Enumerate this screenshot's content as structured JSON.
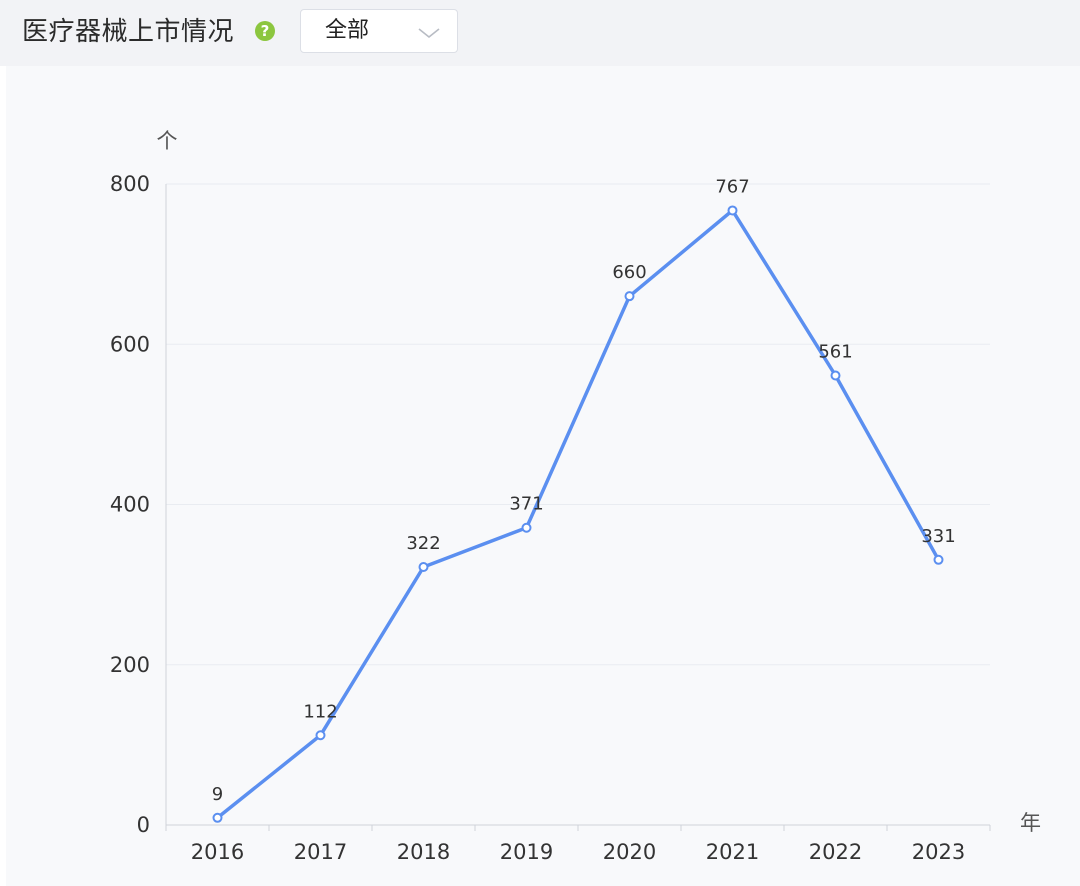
{
  "header": {
    "title": "医疗器械上市情况",
    "help_icon": "question-circle-icon",
    "filter_value": "全部",
    "filter_icon": "chevron-down-icon"
  },
  "colors": {
    "line": "#5b8ff0",
    "help_icon_bg": "#8cc63f",
    "header_bg": "#f2f3f6",
    "plot_bg": "#f8f9fb"
  },
  "chart_data": {
    "type": "line",
    "categories": [
      "2016",
      "2017",
      "2018",
      "2019",
      "2020",
      "2021",
      "2022",
      "2023"
    ],
    "values": [
      9,
      112,
      322,
      371,
      660,
      767,
      561,
      331
    ],
    "title": "",
    "xlabel": "年",
    "ylabel": "个",
    "ylim": [
      0,
      800
    ],
    "yticks": [
      0,
      200,
      400,
      600,
      800
    ],
    "grid": true,
    "data_labels": true,
    "legend": "none"
  }
}
